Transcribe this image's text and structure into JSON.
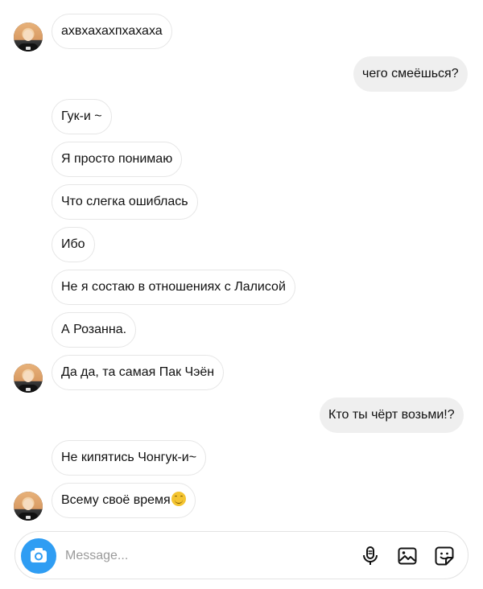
{
  "thread": {
    "messages": [
      {
        "from": "them",
        "text": "ахвхахахпхахаха"
      },
      {
        "from": "me",
        "text": "чего смеёшься?"
      },
      {
        "from": "them",
        "text": "Гук-и ~"
      },
      {
        "from": "them",
        "text": "Я просто понимаю"
      },
      {
        "from": "them",
        "text": "Что слегка ошиблась"
      },
      {
        "from": "them",
        "text": "Ибо"
      },
      {
        "from": "them",
        "text": "Не я состаю в отношениях с Лалисой"
      },
      {
        "from": "them",
        "text": "А Розанна."
      },
      {
        "from": "them",
        "text": "Да да, та самая Пак Чэён"
      },
      {
        "from": "me",
        "text": "Кто ты чёрт возьми!?"
      },
      {
        "from": "them",
        "text": "Не кипятись Чонгук-и~"
      },
      {
        "from": "them",
        "text": "Всему своё время",
        "emoji": "smiling-face-emoji"
      }
    ]
  },
  "composer": {
    "placeholder": "Message...",
    "icons": [
      "camera-icon",
      "microphone-icon",
      "gallery-icon",
      "sticker-icon"
    ]
  },
  "colors": {
    "accent": "#2f9df3",
    "outgoing_bubble": "#efefef",
    "incoming_border": "#e6e6e6",
    "placeholder": "#9a9a9a"
  }
}
